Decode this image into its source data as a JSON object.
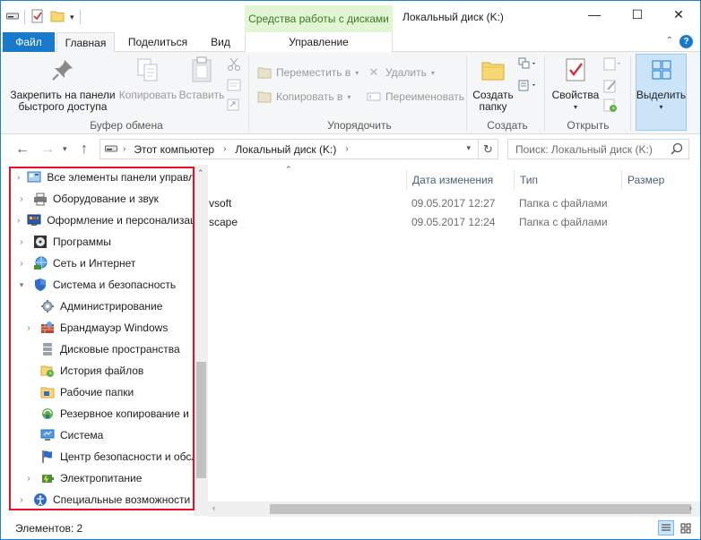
{
  "titlebar": {
    "context_tab_title": "Средства работы с дисками",
    "window_title": "Локальный диск (K:)",
    "minimize": "—",
    "maximize": "☐",
    "close": "✕"
  },
  "tabs": {
    "file": "Файл",
    "home": "Главная",
    "share": "Поделиться",
    "view": "Вид",
    "manage": "Управление",
    "help": "?"
  },
  "ribbon": {
    "pin_label_1": "Закрепить на панели",
    "pin_label_2": "быстрого доступа",
    "copy": "Копировать",
    "paste": "Вставить",
    "group_clipboard": "Буфер обмена",
    "move_to": "Переместить в",
    "copy_to": "Копировать в",
    "delete": "Удалить",
    "rename": "Переименовать",
    "group_organize": "Упорядочить",
    "new_folder_1": "Создать",
    "new_folder_2": "папку",
    "group_new": "Создать",
    "properties": "Свойства",
    "group_open": "Открыть",
    "select": "Выделить"
  },
  "address": {
    "crumb_computer": "Этот компьютер",
    "crumb_disk": "Локальный диск (K:)",
    "search_placeholder": "Поиск: Локальный диск (K:)"
  },
  "nav_tree": {
    "items": [
      {
        "label": "Все элементы панели управления"
      },
      {
        "label": "Оборудование и звук"
      },
      {
        "label": "Оформление и персонализация"
      },
      {
        "label": "Программы"
      },
      {
        "label": "Сеть и Интернет"
      },
      {
        "label": "Система и безопасность"
      },
      {
        "label": "Администрирование"
      },
      {
        "label": "Брандмауэр Windows"
      },
      {
        "label": "Дисковые пространства"
      },
      {
        "label": "История файлов"
      },
      {
        "label": "Рабочие папки"
      },
      {
        "label": "Резервное копирование и восстановление"
      },
      {
        "label": "Система"
      },
      {
        "label": "Центр безопасности и обслуживания"
      },
      {
        "label": "Электропитание"
      },
      {
        "label": "Специальные возможности"
      }
    ]
  },
  "columns": {
    "modified": "Дата изменения",
    "type": "Тип",
    "size": "Размер"
  },
  "files": [
    {
      "name": "vsoft",
      "modified": "09.05.2017 12:27",
      "type": "Папка с файлами"
    },
    {
      "name": "scape",
      "modified": "09.05.2017 12:24",
      "type": "Папка с файлами"
    }
  ],
  "status": {
    "items_count": "Элементов: 2"
  }
}
